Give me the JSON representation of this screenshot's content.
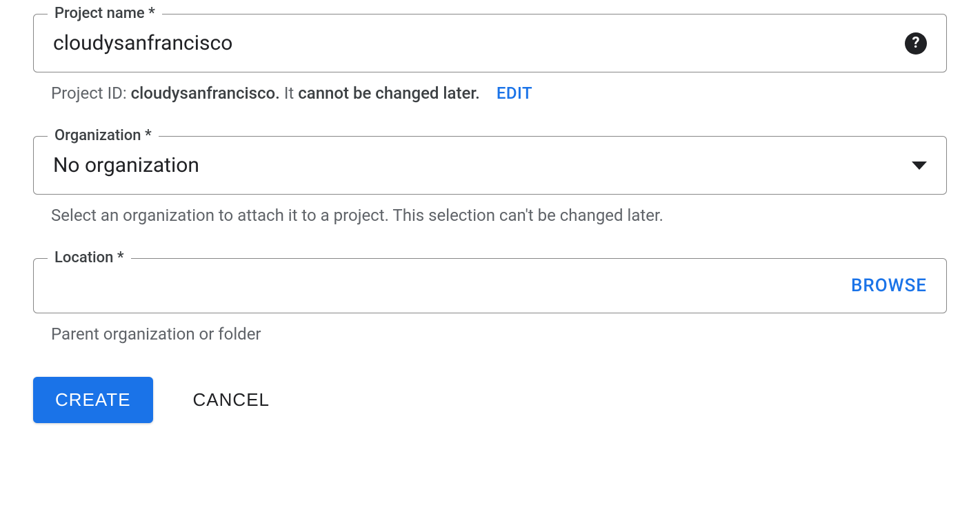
{
  "project_name": {
    "label": "Project name *",
    "value": "cloudysanfrancisco",
    "helper_prefix": "Project ID:",
    "helper_id": "cloudysanfrancisco.",
    "helper_mid": "It",
    "helper_strong": "cannot be changed later.",
    "edit_label": "EDIT"
  },
  "organization": {
    "label": "Organization *",
    "value": "No organization",
    "helper": "Select an organization to attach it to a project. This selection can't be changed later."
  },
  "location": {
    "label": "Location *",
    "value": "",
    "browse_label": "BROWSE",
    "helper": "Parent organization or folder"
  },
  "buttons": {
    "create": "CREATE",
    "cancel": "CANCEL"
  }
}
